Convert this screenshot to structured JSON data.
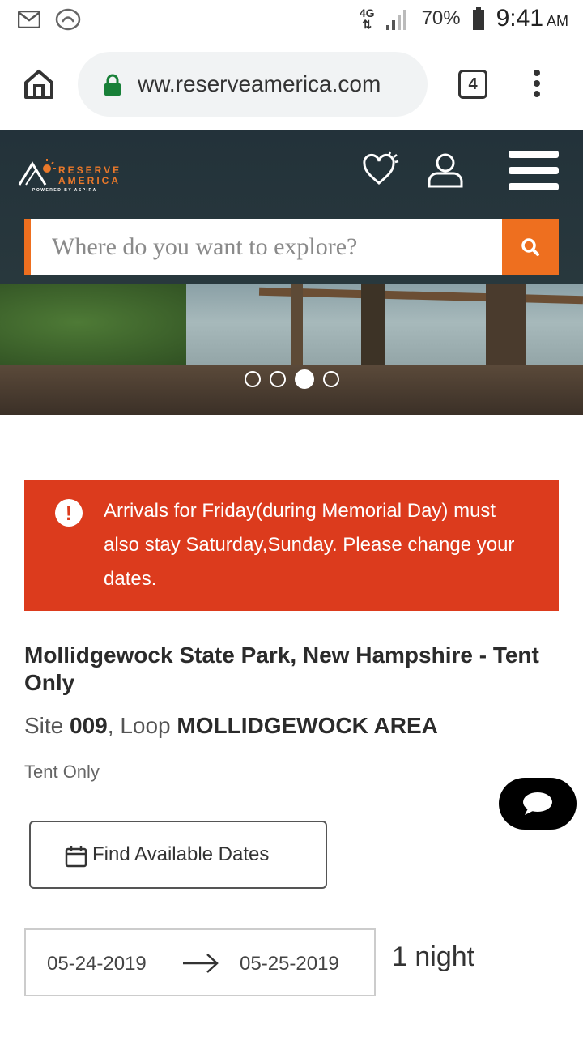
{
  "status_bar": {
    "network": "4G",
    "battery": "70%",
    "time": "9:41",
    "ampm": "AM"
  },
  "browser": {
    "url": "ww.reserveamerica.com",
    "tab_count": "4"
  },
  "header": {
    "logo_line1": "RESERVE",
    "logo_line2": "AMERICA",
    "logo_sub": "POWERED BY ASPIRA",
    "search_placeholder": "Where do you want to explore?"
  },
  "carousel": {
    "slides": 4,
    "active_index": 2
  },
  "alert": {
    "message": "Arrivals for Friday(during Memorial Day) must also stay Saturday,Sunday. Please change your dates.",
    "icon": "exclamation-icon"
  },
  "site": {
    "park_name": "Mollidgewock State Park, New Hampshire - Tent Only",
    "site_label": "Site",
    "site_number": "009",
    "loop_label": "Loop",
    "loop_name": "MOLLIDGEWOCK AREA",
    "site_type": "Tent Only"
  },
  "booking": {
    "find_dates_label": "Find Available Dates",
    "arrival": "05-24-2019",
    "departure": "05-25-2019",
    "nights": "1 night"
  },
  "colors": {
    "accent_orange": "#ee6f1f",
    "alert_red": "#dc3b1d",
    "header_dark": "#23323a"
  }
}
